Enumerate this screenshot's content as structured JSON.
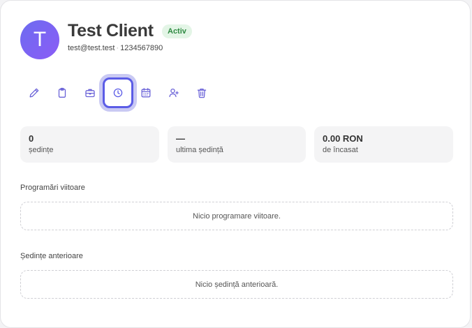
{
  "client": {
    "avatar_letter": "T",
    "name": "Test Client",
    "status": "Activ",
    "email": "test@test.test",
    "separator": "·",
    "phone": "1234567890"
  },
  "toolbar": {
    "items": [
      {
        "icon": "pencil-icon",
        "label": "edit"
      },
      {
        "icon": "clipboard-icon",
        "label": "notes"
      },
      {
        "icon": "briefcase-icon",
        "label": "services"
      },
      {
        "icon": "clock-icon",
        "label": "history",
        "active": true
      },
      {
        "icon": "calendar-icon",
        "label": "schedule"
      },
      {
        "icon": "user-plus-icon",
        "label": "assign"
      },
      {
        "icon": "trash-icon",
        "label": "delete"
      }
    ]
  },
  "stats": [
    {
      "value": "0",
      "label": "ședințe"
    },
    {
      "value": "—",
      "label": "ultima ședință"
    },
    {
      "value": "0.00 RON",
      "label": "de încasat"
    }
  ],
  "sections": {
    "upcoming": {
      "title": "Programări viitoare",
      "empty": "Nicio programare viitoare."
    },
    "past": {
      "title": "Ședințe anterioare",
      "empty": "Nicio ședință anterioară."
    }
  },
  "colors": {
    "accent": "#5b5ce6",
    "accent_ring": "#c9c9f3",
    "badge_bg": "#e3f5e6",
    "badge_text": "#2f8a42",
    "icon": "#6b63d8"
  }
}
